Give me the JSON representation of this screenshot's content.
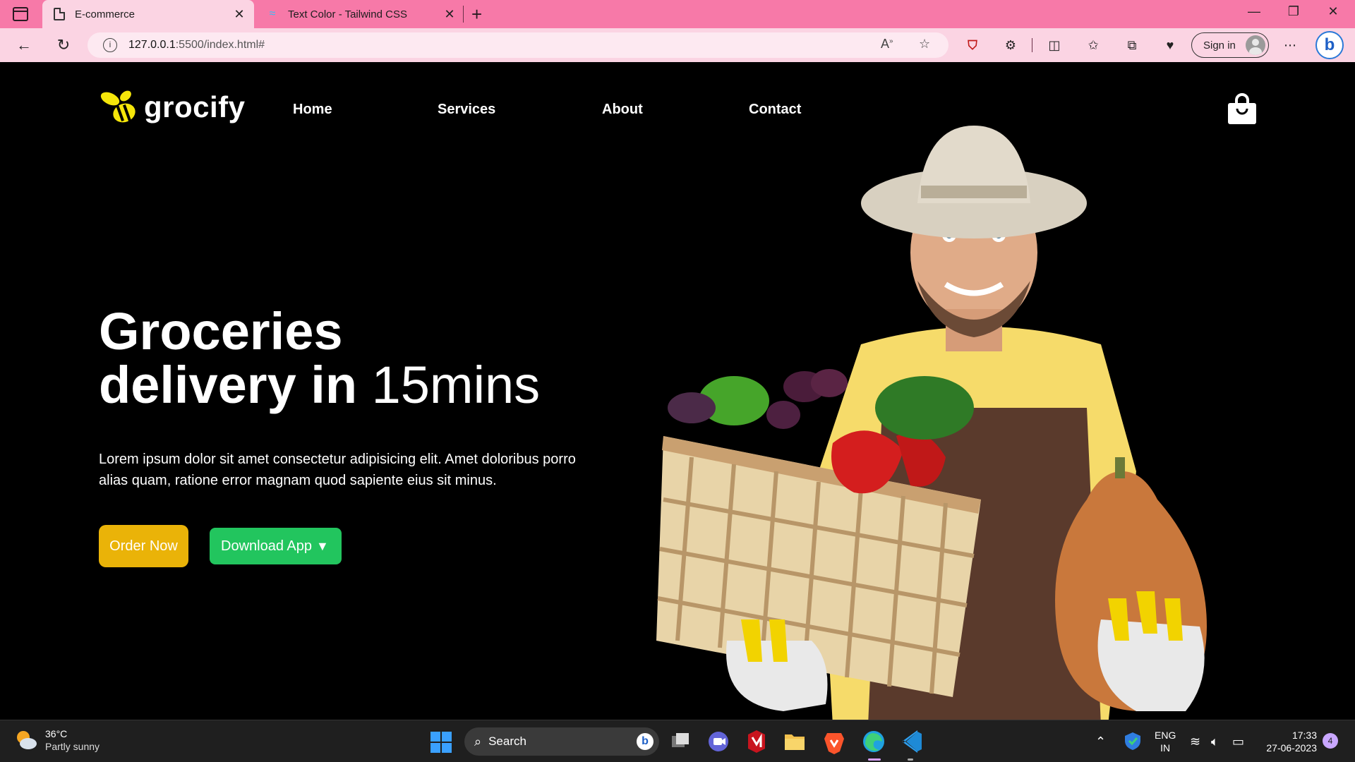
{
  "browser": {
    "tabs": [
      {
        "title": "E-commerce",
        "icon": "document-icon",
        "active": true
      },
      {
        "title": "Text Color - Tailwind CSS",
        "icon": "tailwind-icon",
        "active": false
      }
    ],
    "new_tab_label": "+",
    "url_host": "127.0.0.1",
    "url_path": ":5500/index.html#",
    "signin_label": "Sign in"
  },
  "site": {
    "logo_text": "grocify",
    "nav": [
      "Home",
      "Services",
      "About",
      "Contact"
    ],
    "hero": {
      "title_line1": "Groceries",
      "title_line2_bold": "delivery in",
      "title_line2_normal": "15mins",
      "description": "Lorem ipsum dolor sit amet consectetur adipisicing elit. Amet doloribus porro alias quam, ratione error magnam quod sapiente eius sit minus.",
      "order_button": "Order Now",
      "download_button": "Download App"
    },
    "colors": {
      "accent_yellow": "#eab308",
      "accent_green": "#22c55e",
      "logo_yellow": "#f5e60a"
    }
  },
  "taskbar": {
    "weather_temp": "36°C",
    "weather_desc": "Partly sunny",
    "search_placeholder": "Search",
    "lang_line1": "ENG",
    "lang_line2": "IN",
    "time": "17:33",
    "date": "27-06-2023",
    "notification_count": "4"
  }
}
